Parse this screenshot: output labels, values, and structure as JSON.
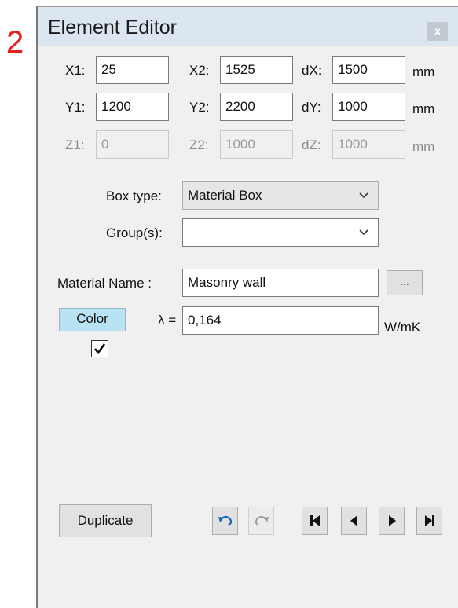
{
  "step_number": "2",
  "window": {
    "title": "Element Editor",
    "close_glyph": "x"
  },
  "coords": [
    [
      {
        "label": "X1:",
        "value": "25",
        "enabled": true
      },
      {
        "label": "X2:",
        "value": "1525",
        "enabled": true
      },
      {
        "label": "dX:",
        "value": "1500",
        "enabled": true
      }
    ],
    [
      {
        "label": "Y1:",
        "value": "1200",
        "enabled": true
      },
      {
        "label": "Y2:",
        "value": "2200",
        "enabled": true
      },
      {
        "label": "dY:",
        "value": "1000",
        "enabled": true
      }
    ],
    [
      {
        "label": "Z1:",
        "value": "0",
        "enabled": false
      },
      {
        "label": "Z2:",
        "value": "1000",
        "enabled": false
      },
      {
        "label": "dZ:",
        "value": "1000",
        "enabled": false
      }
    ]
  ],
  "unit": "mm",
  "box_type": {
    "label": "Box type:",
    "value": "Material Box"
  },
  "groups": {
    "label": "Group(s):",
    "value": ""
  },
  "material": {
    "label": "Material Name :",
    "value": "Masonry wall",
    "browse_label": "..."
  },
  "color_button": {
    "label": "Color",
    "swatch": "#b9e3f2"
  },
  "lambda": {
    "label": "λ =",
    "value": "0,164",
    "unit": "W/mK"
  },
  "checkbox": {
    "checked": true,
    "glyph": "✔"
  },
  "buttons": {
    "duplicate": "Duplicate"
  },
  "icons": {
    "undo": "undo-icon",
    "redo": "redo-icon",
    "first": "skip-first-icon",
    "prev": "previous-icon",
    "next": "next-icon",
    "last": "skip-last-icon"
  },
  "colors": {
    "titlebar": "#dce6f1",
    "panel": "#f0f0f0",
    "step_number": "#e8201c",
    "undo_arrow": "#1565c0"
  }
}
